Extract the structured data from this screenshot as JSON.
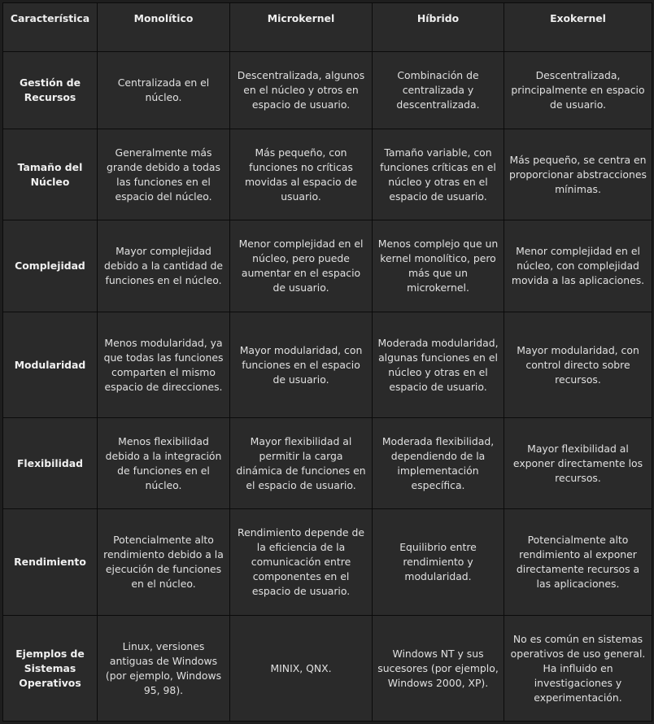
{
  "table": {
    "headers": [
      "Característica",
      "Monolítico",
      "Microkernel",
      "Híbrido",
      "Exokernel"
    ],
    "rows": [
      {
        "feature": "Gestión de Recursos",
        "cells": [
          "Centralizada en el núcleo.",
          "Descentralizada, algunos en el núcleo y otros en espacio de usuario.",
          "Combinación de centralizada y descentralizada.",
          "Descentralizada, principalmente en espacio de usuario."
        ]
      },
      {
        "feature": "Tamaño del Núcleo",
        "cells": [
          "Generalmente más grande debido a todas las funciones en el espacio del núcleo.",
          "Más pequeño, con funciones no críticas movidas al espacio de usuario.",
          "Tamaño variable, con funciones críticas en el núcleo y otras en el espacio de usuario.",
          "Más pequeño, se centra en proporcionar abstracciones mínimas."
        ]
      },
      {
        "feature": "Complejidad",
        "cells": [
          "Mayor complejidad debido a la cantidad de funciones en el núcleo.",
          "Menor complejidad en el núcleo, pero puede aumentar en el espacio de usuario.",
          "Menos complejo que un kernel monolítico, pero más que un microkernel.",
          "Menor complejidad en el núcleo, con complejidad movida a las aplicaciones."
        ]
      },
      {
        "feature": "Modularidad",
        "cells": [
          "Menos modularidad, ya que todas las funciones comparten el mismo espacio de direcciones.",
          "Mayor modularidad, con funciones en el espacio de usuario.",
          "Moderada modularidad, algunas funciones en el núcleo y otras en el espacio de usuario.",
          "Mayor modularidad, con control directo sobre recursos."
        ]
      },
      {
        "feature": "Flexibilidad",
        "cells": [
          "Menos flexibilidad debido a la integración de funciones en el núcleo.",
          "Mayor flexibilidad al permitir la carga dinámica de funciones en el espacio de usuario.",
          "Moderada flexibilidad, dependiendo de la implementación específica.",
          "Mayor flexibilidad al exponer directamente los recursos."
        ]
      },
      {
        "feature": "Rendimiento",
        "cells": [
          "Potencialmente alto rendimiento debido a la ejecución de funciones en el núcleo.",
          "Rendimiento depende de la eficiencia de la comunicación entre componentes en el espacio de usuario.",
          "Equilibrio entre rendimiento y modularidad.",
          "Potencialmente alto rendimiento al exponer directamente recursos a las aplicaciones."
        ]
      },
      {
        "feature": "Ejemplos de Sistemas Operativos",
        "cells": [
          "Linux, versiones antiguas de Windows (por ejemplo, Windows 95, 98).",
          "MINIX, QNX.",
          "Windows NT y sus sucesores (por ejemplo, Windows 2000, XP).",
          "No es común en sistemas operativos de uso general. Ha influido en investigaciones y experimentación."
        ]
      }
    ]
  }
}
